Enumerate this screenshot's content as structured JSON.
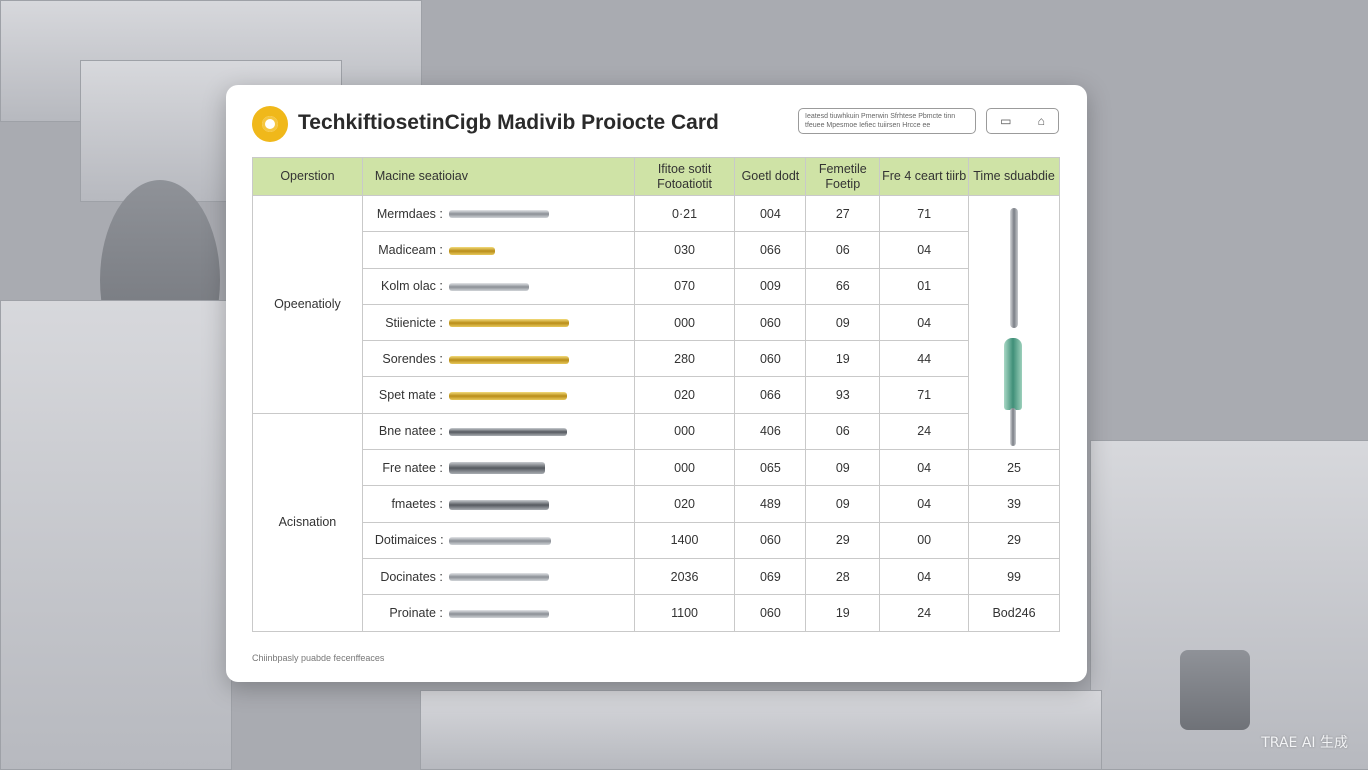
{
  "card": {
    "title": "TechkiftiosetinCigb Madivib Proiocte Card",
    "info_text": "Ieatesd tiuwhkuin Pmerwin Sfrhtese Pbmcte tinn tfeuee Mpesmoe Iefiec tuiirsen Hrcce ee",
    "icons": [
      "document-icon",
      "bookmark-icon"
    ],
    "footer": "Chiinbpasly puabde fecenffeaces"
  },
  "table": {
    "headers": [
      "Operstion",
      "Macine seatioiav",
      "Ifitoe sotit Fotoatiotit",
      "Goetl dodt",
      "Femetile Foetip",
      "Fre 4 ceart tiirb",
      "Time sduabdie"
    ],
    "groups": [
      {
        "label": "Opeenatioly"
      },
      {
        "label": "Acisnation"
      }
    ],
    "rows": [
      {
        "tool": "Mermdaes :",
        "tool_icon": "end-mill-icon",
        "c1": "0·21",
        "c2": "004",
        "c3": "27",
        "c4": "71",
        "c5": ""
      },
      {
        "tool": "Madiceam :",
        "tool_icon": "gold-drill-icon",
        "c1": "030",
        "c2": "066",
        "c3": "06",
        "c4": "04",
        "c5": ""
      },
      {
        "tool": "Kolm olac :",
        "tool_icon": "reamer-icon",
        "c1": "070",
        "c2": "009",
        "c3": "66",
        "c4": "01",
        "c5": ""
      },
      {
        "tool": "Stiienicte :",
        "tool_icon": "gold-tap-icon",
        "c1": "000",
        "c2": "060",
        "c3": "09",
        "c4": "04",
        "c5": ""
      },
      {
        "tool": "Sorendes :",
        "tool_icon": "gold-tap-icon",
        "c1": "280",
        "c2": "060",
        "c3": "19",
        "c4": "44",
        "c5": ""
      },
      {
        "tool": "Spet mate :",
        "tool_icon": "gold-drill-icon",
        "c1": "020",
        "c2": "066",
        "c3": "93",
        "c4": "71",
        "c5": ""
      },
      {
        "tool": "Bne natee :",
        "tool_icon": "cutter-icon",
        "c1": "000",
        "c2": "406",
        "c3": "06",
        "c4": "24",
        "c5": ""
      },
      {
        "tool": "Fre natee :",
        "tool_icon": "boring-bar-icon",
        "c1": "000",
        "c2": "065",
        "c3": "09",
        "c4": "04",
        "c5": "25"
      },
      {
        "tool": "fmaetes :",
        "tool_icon": "chamfer-tool-icon",
        "c1": "020",
        "c2": "489",
        "c3": "09",
        "c4": "04",
        "c5": "39"
      },
      {
        "tool": "Dotimaices :",
        "tool_icon": "end-mill-icon",
        "c1": "1400",
        "c2": "060",
        "c3": "29",
        "c4": "00",
        "c5": "29"
      },
      {
        "tool": "Docinates :",
        "tool_icon": "threading-tool-icon",
        "c1": "2036",
        "c2": "069",
        "c3": "28",
        "c4": "04",
        "c5": "99"
      },
      {
        "tool": "Proinate :",
        "tool_icon": "threading-tool-icon",
        "c1": "1100",
        "c2": "060",
        "c3": "19",
        "c4": "24",
        "c5": "Bod246"
      }
    ]
  },
  "watermark": "TRAE AI 生成"
}
